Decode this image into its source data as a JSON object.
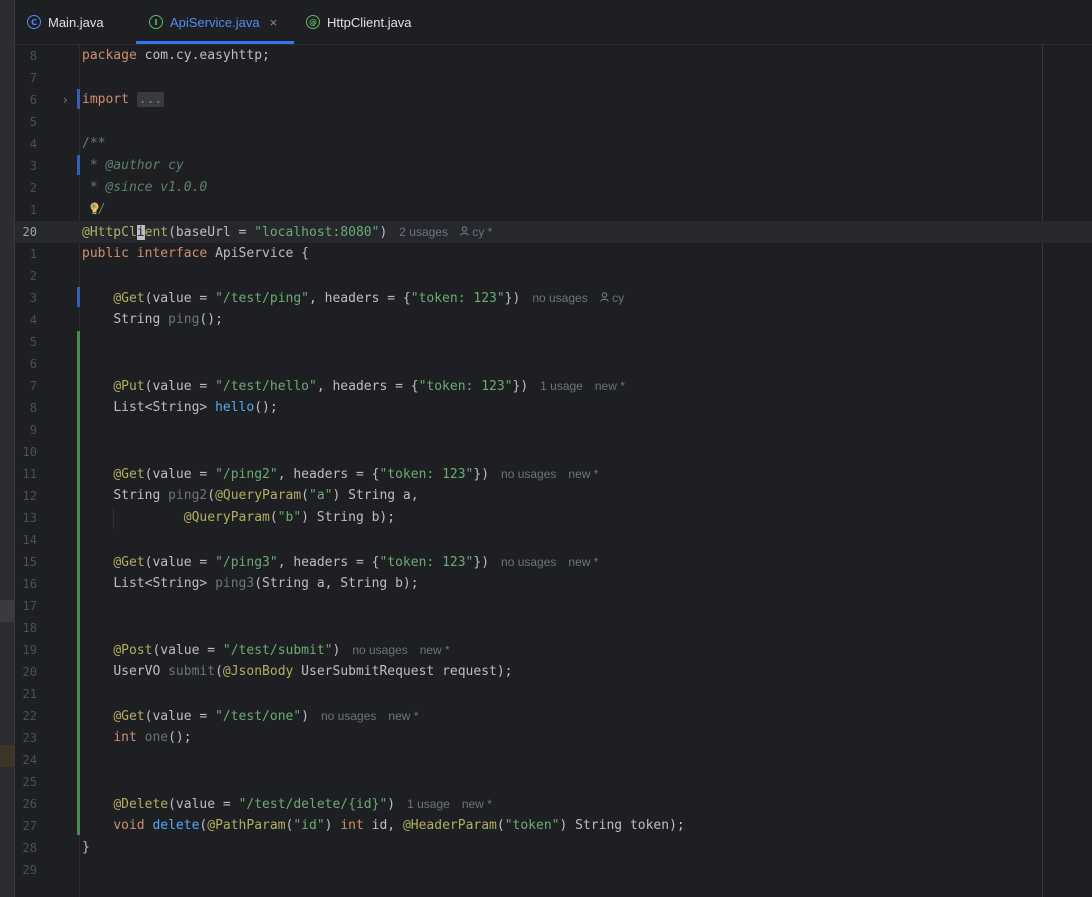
{
  "tabs": [
    {
      "label": "Main.java",
      "icon": "clock-class-icon",
      "active": false
    },
    {
      "label": "ApiService.java",
      "icon": "interface-icon",
      "active": true,
      "close": "×"
    },
    {
      "label": "HttpClient.java",
      "icon": "annotation-icon",
      "active": false
    }
  ],
  "icons": {
    "main": "C",
    "api": "I",
    "http": "@"
  },
  "editor": {
    "line_numbers": [
      "8",
      "7",
      "6",
      "5",
      "4",
      "3",
      "2",
      "1",
      "20",
      "1",
      "2",
      "3",
      "4",
      "5",
      "6",
      "7",
      "8",
      "9",
      "10",
      "11",
      "12",
      "13",
      "14",
      "15",
      "16",
      "17",
      "18",
      "19",
      "20",
      "21",
      "22",
      "23",
      "24",
      "25",
      "26",
      "27",
      "28",
      "29"
    ],
    "code": {
      "package_kw": "package",
      "package_name": " com.cy.easyhttp;",
      "import_kw": "import",
      "import_fold": "...",
      "doc_open": "/**",
      "doc_author_star": " * ",
      "doc_author": "@author cy",
      "doc_since_star": " * ",
      "doc_since": "@since v1.0.0",
      "doc_close": " */",
      "class_ann_1": "@HttpCl",
      "class_ann_caret": "i",
      "class_ann_2": "ent",
      "class_ann_args_1": "(baseUrl = ",
      "class_ann_str": "\"localhost:8080\"",
      "class_ann_args_2": ")",
      "iface_kw1": "public",
      "iface_kw2": "interface",
      "iface_name": " ApiService {",
      "m1_ann": "@Get",
      "m1_a": "(value = ",
      "m1_s1": "\"/test/ping\"",
      "m1_b": ", headers = {",
      "m1_s2": "\"token: 123\"",
      "m1_c": "})",
      "m1_type": "String ",
      "m1_name": "ping",
      "m1_end": "();",
      "m2_ann": "@Put",
      "m2_a": "(value = ",
      "m2_s1": "\"/test/hello\"",
      "m2_b": ", headers = {",
      "m2_s2": "\"token: 123\"",
      "m2_c": "})",
      "m2_type": "List<String> ",
      "m2_name": "hello",
      "m2_end": "();",
      "m3_ann": "@Get",
      "m3_a": "(value = ",
      "m3_s1": "\"/ping2\"",
      "m3_b": ", headers = {",
      "m3_s2": "\"token: 123\"",
      "m3_c": "})",
      "m3_type": "String ",
      "m3_name": "ping2",
      "m3_p1open": "(",
      "m3_qp1": "@QueryParam",
      "m3_q1a": "(",
      "m3_q1s": "\"a\"",
      "m3_q1b": ") String a,",
      "m3_qp2": "@QueryParam",
      "m3_q2a": "(",
      "m3_q2s": "\"b\"",
      "m3_q2b": ") String b);",
      "m4_ann": "@Get",
      "m4_a": "(value = ",
      "m4_s1": "\"/ping3\"",
      "m4_b": ", headers = {",
      "m4_s2": "\"token: 123\"",
      "m4_c": "})",
      "m4_type": "List<String> ",
      "m4_name": "ping3",
      "m4_end": "(String a, String b);",
      "m5_ann": "@Post",
      "m5_a": "(value = ",
      "m5_s1": "\"/test/submit\"",
      "m5_c": ")",
      "m5_type": "UserVO ",
      "m5_name": "submit",
      "m5_open": "(",
      "m5_pann": "@JsonBody",
      "m5_end": " UserSubmitRequest request);",
      "m6_ann": "@Get",
      "m6_a": "(value = ",
      "m6_s1": "\"/test/one\"",
      "m6_c": ")",
      "m6_type": "int",
      "m6_name": "one",
      "m6_end": "();",
      "m7_ann": "@Delete",
      "m7_a": "(value = ",
      "m7_s1": "\"/test/delete/{id}\"",
      "m7_c": ")",
      "m7_type": "void",
      "m7_name": "delete",
      "m7_open": "(",
      "m7_p1ann": "@PathParam",
      "m7_p1a": "(",
      "m7_p1s": "\"id\"",
      "m7_p1b": ") ",
      "m7_p1type": "int",
      "m7_p1c": " id, ",
      "m7_p2ann": "@HeaderParam",
      "m7_p2a": "(",
      "m7_p2s": "\"token\"",
      "m7_p2b": ") String token);",
      "close_brace": "}"
    },
    "hints": {
      "class_usages": "2 usages",
      "class_author": "cy *",
      "m1_usages": "no usages",
      "m1_author": "cy",
      "m2_usages": "1 usage",
      "m2_author": "new *",
      "m3_usages": "no usages",
      "m3_author": "new *",
      "m4_usages": "no usages",
      "m4_author": "new *",
      "m5_usages": "no usages",
      "m5_author": "new *",
      "m6_usages": "no usages",
      "m6_author": "new *",
      "m7_usages": "1 usage",
      "m7_author": "new *"
    },
    "fold_arrow": "›"
  },
  "colors": {
    "background": "#1e1f22",
    "keyword": "#cf8e6d",
    "annotation": "#b3ae60",
    "string": "#6aab73",
    "method": "#56a8f5",
    "accent": "#3574f0",
    "vcs_added": "#4e8a4f",
    "vcs_modified": "#375fad"
  }
}
